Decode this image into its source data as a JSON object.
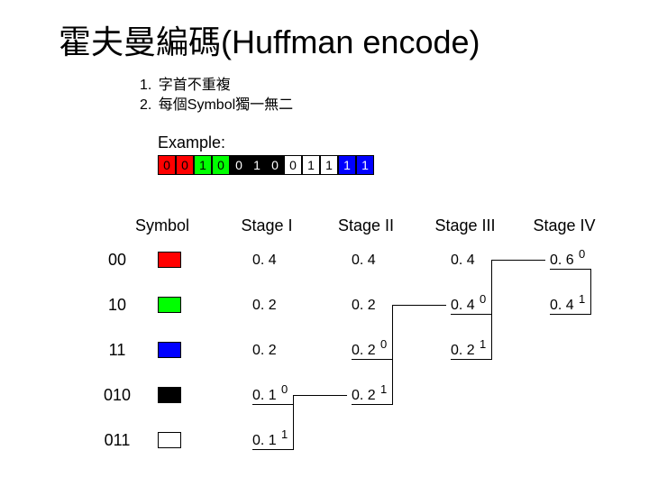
{
  "title": "霍夫曼編碼(Huffman encode)",
  "rules": {
    "r1": "字首不重複",
    "r2": "每個Symbol獨一無二"
  },
  "example": {
    "label": "Example:",
    "bits": [
      "0",
      "0",
      "1",
      "0",
      "0",
      "1",
      "0",
      "0",
      "1",
      "1",
      "1",
      "1"
    ],
    "colors": [
      "red",
      "red",
      "green",
      "green",
      "black",
      "black",
      "black",
      "white",
      "white",
      "white",
      "blue",
      "blue"
    ]
  },
  "headers": {
    "symbol": "Symbol",
    "s1": "Stage I",
    "s2": "Stage II",
    "s3": "Stage III",
    "s4": "Stage IV"
  },
  "symbols": {
    "s0": "00",
    "s1": "10",
    "s2": "11",
    "s3": "010",
    "s4": "011"
  },
  "values": {
    "c1r1": "0. 4",
    "c1r2": "0. 2",
    "c1r3": "0. 2",
    "c1r4": "0. 1",
    "c1r5": "0. 1",
    "c2r1": "0. 4",
    "c2r2": "0. 2",
    "c2r3": "0. 2",
    "c2r4": "0. 2",
    "c3r1": "0. 4",
    "c3r2": "0. 4",
    "c3r3": "0. 2",
    "c4r1": "0. 6",
    "c4r2": "0. 4"
  },
  "sups": {
    "c1r4": "0",
    "c1r5": "1",
    "c2r3": "0",
    "c2r4": "1",
    "c3r2": "0",
    "c3r3": "1",
    "c4r1": "0",
    "c4r2": "1"
  },
  "chart_data": {
    "type": "table",
    "title": "Huffman merge stages",
    "stages": [
      {
        "name": "Stage I",
        "probs": [
          0.4,
          0.2,
          0.2,
          0.1,
          0.1
        ],
        "merge_bits": [
          null,
          null,
          null,
          "0",
          "1"
        ]
      },
      {
        "name": "Stage II",
        "probs": [
          0.4,
          0.2,
          0.2,
          0.2
        ],
        "merge_bits": [
          null,
          null,
          "0",
          "1"
        ]
      },
      {
        "name": "Stage III",
        "probs": [
          0.4,
          0.4,
          0.2
        ],
        "merge_bits": [
          null,
          "0",
          "1"
        ]
      },
      {
        "name": "Stage IV",
        "probs": [
          0.6,
          0.4
        ],
        "merge_bits": [
          "0",
          "1"
        ]
      }
    ],
    "symbols": [
      {
        "code": "00",
        "color": "#FF0000"
      },
      {
        "code": "10",
        "color": "#00FF00"
      },
      {
        "code": "11",
        "color": "#0000FF"
      },
      {
        "code": "010",
        "color": "#000000"
      },
      {
        "code": "011",
        "color": "#FFFFFF"
      }
    ],
    "example_stream": "001001001111"
  }
}
